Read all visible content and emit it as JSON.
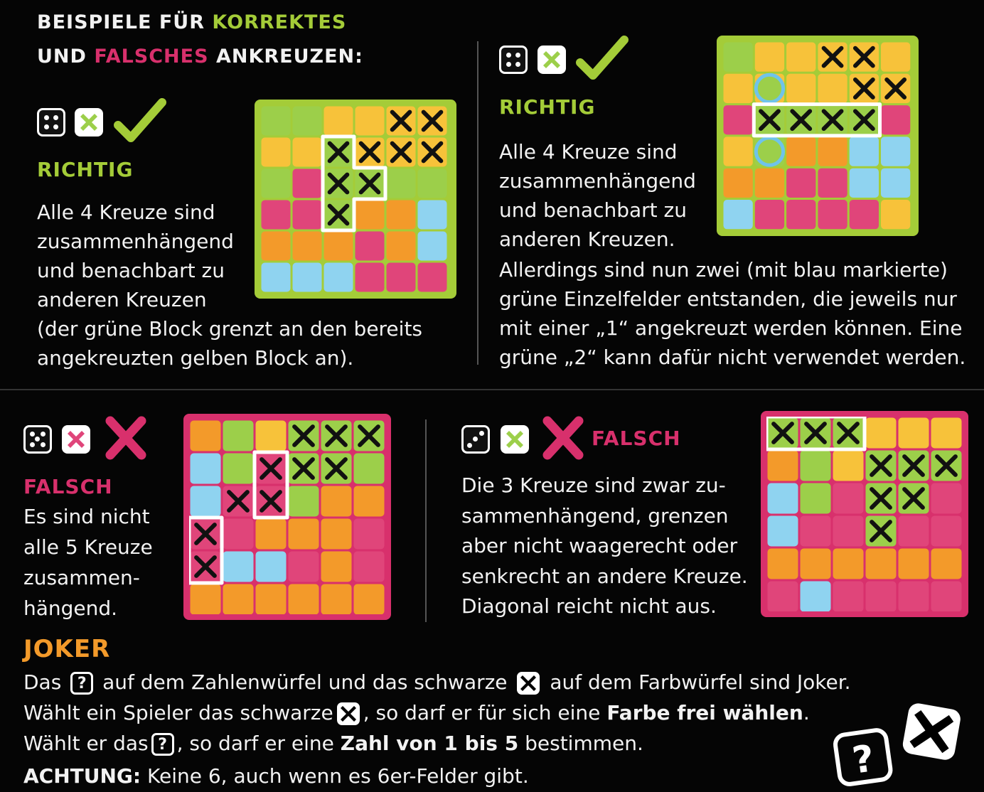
{
  "heading": {
    "line1_a": "BEISPIELE FÜR ",
    "line1_b": "KORREKTES",
    "line2_a": "UND ",
    "line2_b": "FALSCHES",
    "line2_c": " ANKREUZEN:"
  },
  "example1": {
    "die_pips": 4,
    "color_die": "green",
    "mark": "check",
    "label": "RICHTIG",
    "text": "Alle 4 Kreuze sind\nzusammenhängend\nund benachbart zu\nanderen Kreuzen\n(der grüne Block grenzt an den bereits\nangekreuzten gelben Block an)."
  },
  "example2": {
    "die_pips": 4,
    "color_die": "green",
    "mark": "check",
    "label": "RICHTIG",
    "text_short": "Alle 4 Kreuze sind\nzusammenhängend\nund benachbart zu\nanderen Kreuzen.",
    "text_long": "Allerdings sind nun zwei (mit blau markierte)\ngrüne Einzelfelder entstanden, die jeweils nur\nmit einer „1“ angekreuzt werden können. Eine\ngrüne „2“ kann dafür nicht verwendet werden."
  },
  "example3": {
    "die_pips": 5,
    "color_die": "pink",
    "mark": "cross",
    "label": "FALSCH",
    "text": "Es sind nicht\nalle 5 Kreuze\nzusammen-\nhängend."
  },
  "example4": {
    "die_pips": 3,
    "color_die": "green",
    "mark": "cross",
    "label": "FALSCH",
    "text": "Die 3 Kreuze sind zwar zu-\nsammenhängend, grenzen\naber nicht waagerecht oder\nsenkrecht an andere Kreuze.\nDiagonal reicht nicht aus."
  },
  "joker": {
    "title": "JOKER",
    "l1_a": "Das",
    "l1_b": "auf dem Zahlenwürfel und das schwarze",
    "l1_c": "auf dem Farbwürfel sind Joker.",
    "l2_a": "Wählt ein Spieler das schwarze",
    "l2_b": ", so darf er für sich eine",
    "l2_bold": "Farbe frei wählen",
    "l2_c": ".",
    "l3_a": "Wählt er das",
    "l3_b": ", so darf er eine",
    "l3_bold": "Zahl von 1 bis 5",
    "l3_c": "bestimmen.",
    "l4_bold": "ACHTUNG:",
    "l4_rest": " Keine 6, auch wenn es 6er-Felder gibt.",
    "q_symbol": "?"
  },
  "colors": {
    "lime": "#a4cc38",
    "pink": "#d8306c",
    "orange": "#f39a2a",
    "yellow": "#f7c23a",
    "blue": "#8fd3f0",
    "green": "#9ccf4a",
    "magenta": "#e0457a"
  }
}
